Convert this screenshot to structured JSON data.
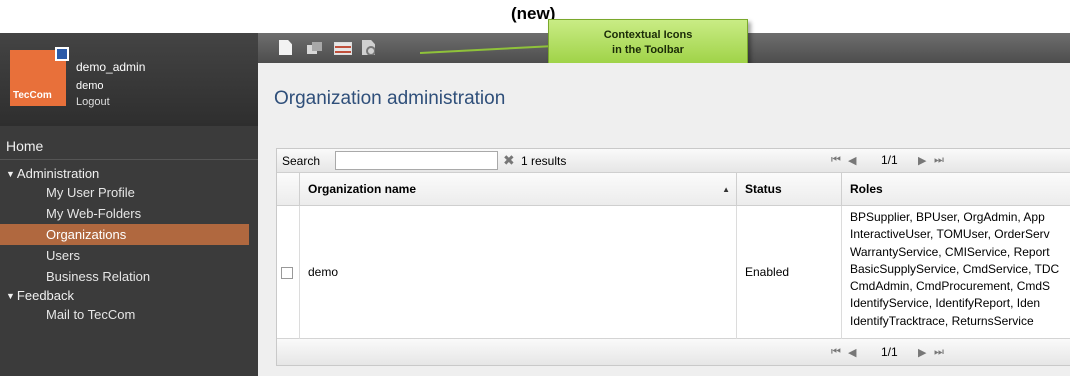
{
  "slide_title": "(new)",
  "user": {
    "name": "demo_admin",
    "org": "demo",
    "logout_label": "Logout",
    "logo_text": "TecCom"
  },
  "nav": {
    "home_label": "Home",
    "sections": [
      {
        "label": "Administration",
        "items": [
          "My User Profile",
          "My Web-Folders",
          "Organizations",
          "Users",
          "Business Relation"
        ],
        "active": "Organizations"
      },
      {
        "label": "Feedback",
        "items": [
          "Mail to TecCom"
        ]
      }
    ]
  },
  "toolbar": {
    "icons": [
      "new-document-icon",
      "copy-icon",
      "table-icon",
      "export-icon"
    ],
    "callout": {
      "line1": "Contextual Icons",
      "line2": "in the Toolbar"
    }
  },
  "page": {
    "title": "Organization administration"
  },
  "grid": {
    "search_label": "Search",
    "search_value": "",
    "results_text": "1 results",
    "pager_text": "1/1",
    "columns": [
      "Organization name",
      "Status",
      "Roles"
    ],
    "rows": [
      {
        "name": "demo",
        "status": "Enabled",
        "roles": [
          "BPSupplier, BPUser, OrgAdmin, App",
          "InteractiveUser, TOMUser, OrderServ",
          "WarrantyService, CMIService, Report",
          "BasicSupplyService, CmdService, TDC",
          "CmdAdmin, CmdProcurement, CmdS",
          "IdentifyService, IdentifyReport, Iden",
          "IdentifyTracktrace, ReturnsService"
        ]
      }
    ]
  },
  "colors": {
    "sidebar": "#3b3b3b",
    "active_item": "#b0683f",
    "title": "#2f4f7a",
    "callout": "#b5e05f",
    "logo": "#e8703a"
  }
}
